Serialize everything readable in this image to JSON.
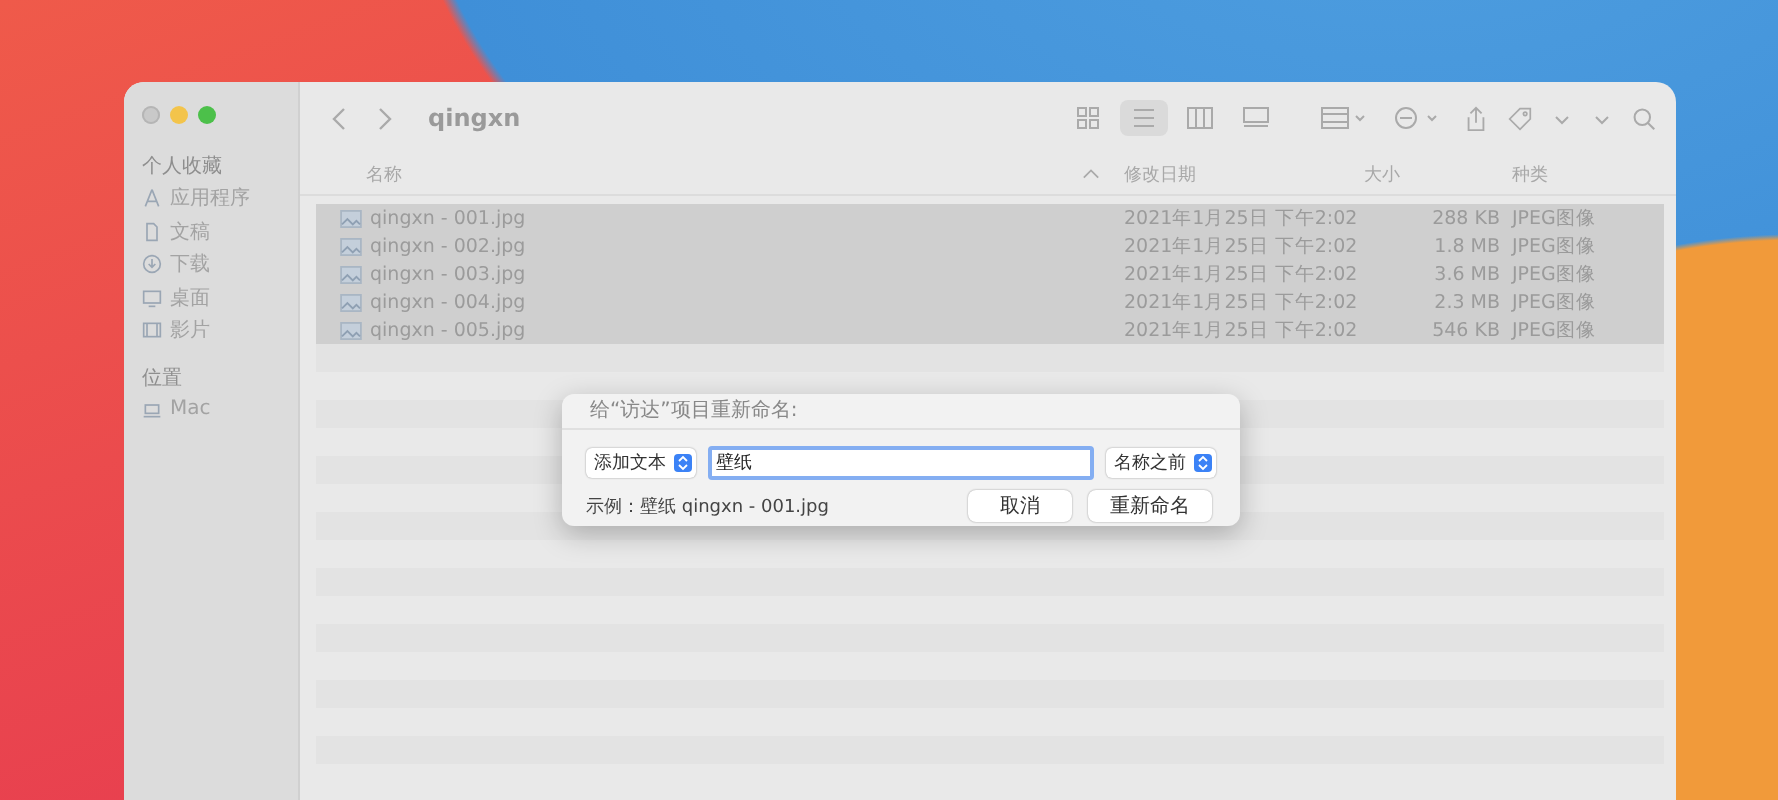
{
  "window": {
    "title": "qingxn"
  },
  "sidebar": {
    "sections": [
      {
        "heading": "个人收藏",
        "items": [
          {
            "label": "应用程序",
            "kind": "app"
          },
          {
            "label": "文稿",
            "kind": "doc"
          },
          {
            "label": "下载",
            "kind": "download"
          },
          {
            "label": "桌面",
            "kind": "desktop"
          },
          {
            "label": "影片",
            "kind": "movie"
          }
        ]
      },
      {
        "heading": "位置",
        "items": [
          {
            "label": "Mac",
            "kind": "computer"
          }
        ]
      }
    ]
  },
  "toolbar": {
    "views": [
      {
        "kind": "icons",
        "selected": false
      },
      {
        "kind": "list",
        "selected": true
      },
      {
        "kind": "columns",
        "selected": false
      },
      {
        "kind": "gallery",
        "selected": false
      }
    ]
  },
  "table": {
    "columns": [
      {
        "label": "名称",
        "sorted": true
      },
      {
        "label": "修改日期",
        "sorted": false
      },
      {
        "label": "大小",
        "sorted": false
      },
      {
        "label": "种类",
        "sorted": false
      }
    ],
    "rows": [
      {
        "name": "qingxn - 001.jpg",
        "date": "2021年1月25日 下午2:02",
        "size": "288 KB",
        "kind": "JPEG图像",
        "selected": true
      },
      {
        "name": "qingxn - 002.jpg",
        "date": "2021年1月25日 下午2:02",
        "size": "1.8 MB",
        "kind": "JPEG图像",
        "selected": true
      },
      {
        "name": "qingxn - 003.jpg",
        "date": "2021年1月25日 下午2:02",
        "size": "3.6 MB",
        "kind": "JPEG图像",
        "selected": true
      },
      {
        "name": "qingxn - 004.jpg",
        "date": "2021年1月25日 下午2:02",
        "size": "2.3 MB",
        "kind": "JPEG图像",
        "selected": true
      },
      {
        "name": "qingxn - 005.jpg",
        "date": "2021年1月25日 下午2:02",
        "size": "546 KB",
        "kind": "JPEG图像",
        "selected": true
      }
    ]
  },
  "dialog": {
    "title": "给“访达”项目重新命名:",
    "action": "添加文本",
    "text_value": "壁纸",
    "position": "名称之前",
    "example": "示例：壁纸 qingxn - 001.jpg",
    "buttons": [
      "取消",
      "重新命名"
    ]
  }
}
